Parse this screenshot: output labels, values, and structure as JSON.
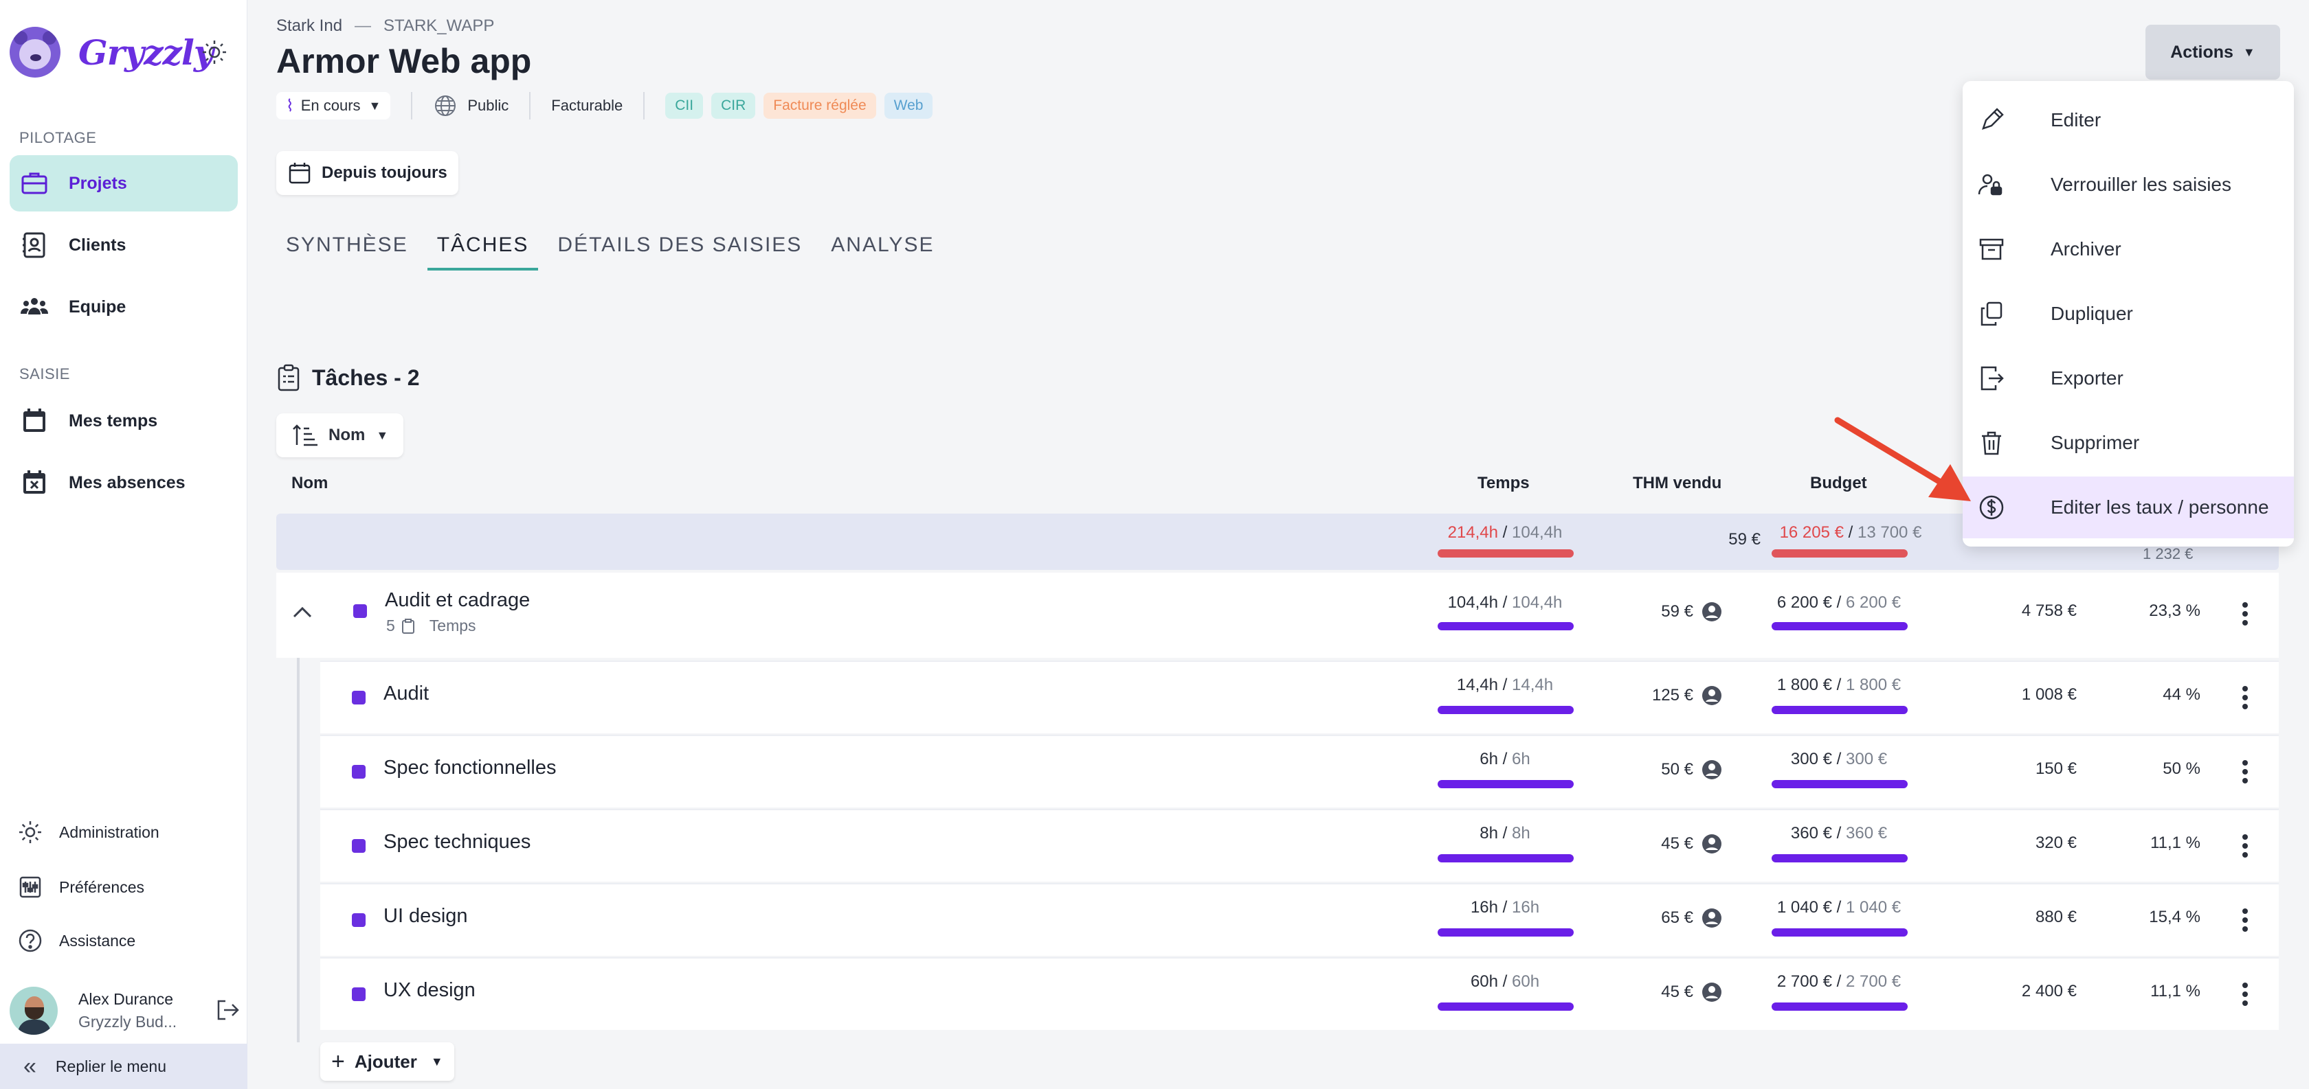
{
  "sidebar": {
    "brand": "Gryzzly",
    "section_pilotage": "PILOTAGE",
    "section_saisie": "SAISIE",
    "items": [
      {
        "label": "Projets",
        "icon": "briefcase-icon",
        "active": true
      },
      {
        "label": "Clients",
        "icon": "contact-card-icon"
      },
      {
        "label": "Equipe",
        "icon": "team-icon"
      },
      {
        "label": "Mes temps",
        "icon": "calendar-icon"
      },
      {
        "label": "Mes absences",
        "icon": "calendar-x-icon"
      }
    ],
    "bottom": [
      {
        "label": "Administration",
        "icon": "gear-icon"
      },
      {
        "label": "Préférences",
        "icon": "sliders-icon"
      },
      {
        "label": "Assistance",
        "icon": "help-icon"
      }
    ],
    "user": {
      "name": "Alex Durance",
      "org": "Gryzzly Bud..."
    },
    "collapse_label": "Replier le menu"
  },
  "header": {
    "client": "Stark Ind",
    "separator": "—",
    "code": "STARK_WAPP",
    "title": "Armor Web app",
    "status": "En cours",
    "visibility": "Public",
    "billing": "Facturable",
    "tags": [
      {
        "label": "CII",
        "style": "teal"
      },
      {
        "label": "CIR",
        "style": "teal"
      },
      {
        "label": "Facture réglée",
        "style": "orange"
      },
      {
        "label": "Web",
        "style": "blue"
      }
    ],
    "date_filter": "Depuis toujours",
    "actions_label": "Actions"
  },
  "tabs": [
    {
      "label": "SYNTHÈSE",
      "active": false
    },
    {
      "label": "TÂCHES",
      "active": true
    },
    {
      "label": "DÉTAILS DES SAISIES",
      "active": false
    },
    {
      "label": "ANALYSE",
      "active": false
    }
  ],
  "tasks": {
    "title": "Tâches - 2",
    "sort_label": "Nom",
    "columns": {
      "name": "Nom",
      "time": "Temps",
      "thm": "THM vendu",
      "budget": "Budget"
    },
    "total": {
      "time_spent": "214,4h",
      "time_planned": "104,4h",
      "thm": "59 €",
      "budget_spent": "16 205 €",
      "budget_planned": "13 700 €",
      "peek": "1 232 €"
    },
    "group": {
      "name": "Audit et cadrage",
      "count": "5",
      "sub_label": "Temps",
      "time_spent": "104,4h",
      "time_planned": "104,4h",
      "thm": "59 €",
      "budget_spent": "6 200 €",
      "budget_planned": "6 200 €",
      "amount": "4 758 €",
      "percent": "23,3 %"
    },
    "rows": [
      {
        "name": "Audit",
        "time_spent": "14,4h",
        "time_planned": "14,4h",
        "thm": "125 €",
        "budget_spent": "1 800 €",
        "budget_planned": "1 800 €",
        "amount": "1 008 €",
        "percent": "44 %"
      },
      {
        "name": "Spec fonctionnelles",
        "time_spent": "6h",
        "time_planned": "6h",
        "thm": "50 €",
        "budget_spent": "300 €",
        "budget_planned": "300 €",
        "amount": "150 €",
        "percent": "50 %"
      },
      {
        "name": "Spec techniques",
        "time_spent": "8h",
        "time_planned": "8h",
        "thm": "45 €",
        "budget_spent": "360 €",
        "budget_planned": "360 €",
        "amount": "320 €",
        "percent": "11,1 %"
      },
      {
        "name": "UI design",
        "time_spent": "16h",
        "time_planned": "16h",
        "thm": "65 €",
        "budget_spent": "1 040 €",
        "budget_planned": "1 040 €",
        "amount": "880 €",
        "percent": "15,4 %"
      },
      {
        "name": "UX design",
        "time_spent": "60h",
        "time_planned": "60h",
        "thm": "45 €",
        "budget_spent": "2 700 €",
        "budget_planned": "2 700 €",
        "amount": "2 400 €",
        "percent": "11,1 %"
      }
    ],
    "add_label": "Ajouter"
  },
  "actions_menu": [
    {
      "label": "Editer",
      "icon": "pencil-icon"
    },
    {
      "label": "Verrouiller les saisies",
      "icon": "user-lock-icon"
    },
    {
      "label": "Archiver",
      "icon": "archive-icon"
    },
    {
      "label": "Dupliquer",
      "icon": "duplicate-icon"
    },
    {
      "label": "Exporter",
      "icon": "export-icon"
    },
    {
      "label": "Supprimer",
      "icon": "trash-icon"
    },
    {
      "label": "Editer les taux / personne",
      "icon": "dollar-circle-icon",
      "highlighted": true
    }
  ],
  "colors": {
    "accent": "#6a2fe0",
    "active_nav_bg": "#c9ece9",
    "overrun": "#e0484b",
    "arrow": "#e8452f"
  }
}
